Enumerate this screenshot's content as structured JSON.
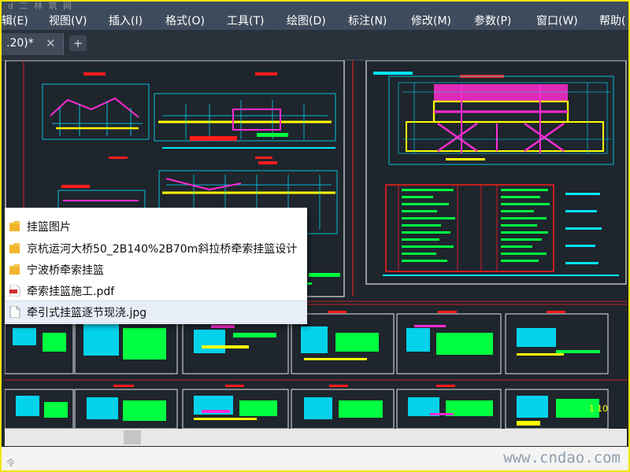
{
  "app": {
    "title_fragment": "d 二 林 筑 网"
  },
  "menubar": {
    "items": [
      "辑(E)",
      "视图(V)",
      "插入(I)",
      "格式(O)",
      "工具(T)",
      "绘图(D)",
      "标注(N)",
      "修改(M)",
      "参数(P)",
      "窗口(W)",
      "帮助("
    ]
  },
  "tabs": {
    "active_label": ".20)*",
    "close_glyph": "✕",
    "add_glyph": "+"
  },
  "drawing_labels": {
    "table_marker_1": "1",
    "table_marker_2": "10"
  },
  "popup": {
    "items": [
      {
        "label": "挂篮图片",
        "icon": "folder-icon"
      },
      {
        "label": "京杭运河大桥50_2B140%2B70m斜拉桥牵索挂篮设计",
        "icon": "folder-icon"
      },
      {
        "label": "宁波桥牵索挂篮",
        "icon": "folder-icon"
      },
      {
        "label": "牵索挂篮施工.pdf",
        "icon": "pdf-file-icon"
      },
      {
        "label": "牵引式挂篮逐节现浇.jpg",
        "icon": "image-file-icon",
        "highlighted": true
      }
    ]
  },
  "command_line": {
    "text": "令"
  },
  "watermark": {
    "text": "www.cndao.com"
  },
  "colors": {
    "frame_border": "#f2e400",
    "menubar_bg": "#3e4b5c",
    "canvas_bg": "#1e252d",
    "cad_cyan": "#00e5ff",
    "cad_magenta": "#ff2bd0",
    "cad_green": "#00ff40",
    "cad_yellow": "#ffff00",
    "cad_red": "#ff1c1c"
  }
}
